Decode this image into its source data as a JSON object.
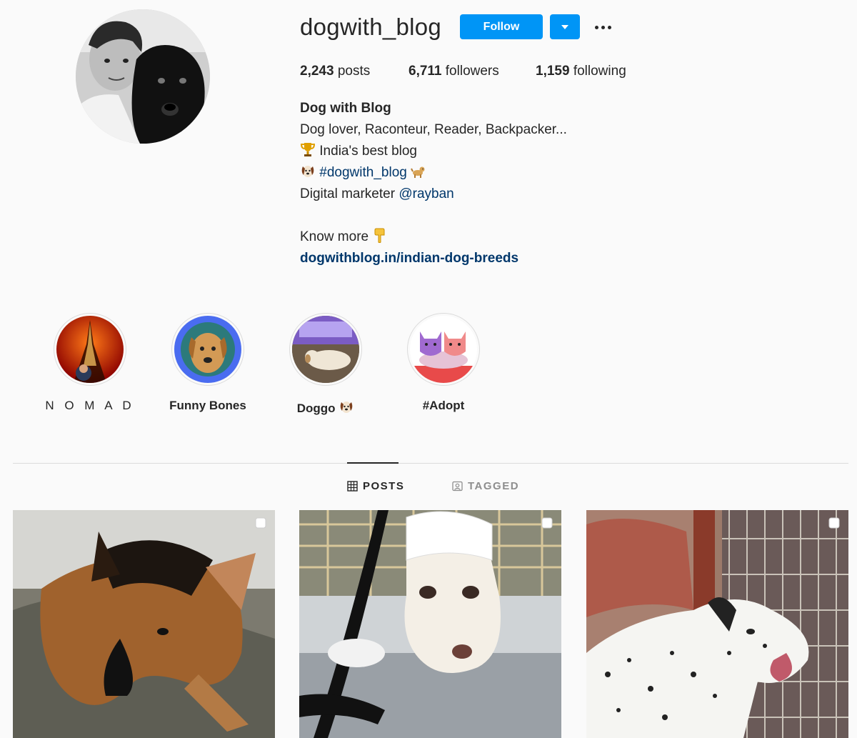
{
  "profile": {
    "username": "dogwith_blog",
    "follow_label": "Follow",
    "stats": {
      "posts_count": "2,243",
      "posts_label": "posts",
      "followers_count": "6,711",
      "followers_label": "followers",
      "following_count": "1,159",
      "following_label": "following"
    },
    "bio": {
      "full_name": "Dog with Blog",
      "line1": "Dog lover, Raconteur, Reader, Backpacker...",
      "line2": "India's best blog",
      "hashtag": "#dogwith_blog",
      "line4_text": "Digital marketer",
      "mention": "@rayban",
      "know_more": "Know more",
      "website": "dogwithblog.in/indian-dog-breeds"
    }
  },
  "highlights": [
    {
      "label": "N O M A D",
      "icon": "eiffel-tower"
    },
    {
      "label": "Funny Bones",
      "icon": "puppy"
    },
    {
      "label": "Doggo",
      "icon": "sleeping-dog"
    },
    {
      "label": "#Adopt",
      "icon": "cartoon-cats"
    }
  ],
  "tabs": {
    "posts": "POSTS",
    "tagged": "TAGGED",
    "active": "posts"
  },
  "posts": [
    {
      "subject": "german-shepherd",
      "multi": true
    },
    {
      "subject": "white-dog-bandaged",
      "multi": true
    },
    {
      "subject": "dalmatian",
      "multi": true
    }
  ],
  "colors": {
    "accent": "#0095f6",
    "text": "#262626",
    "muted": "#8e8e8e",
    "link": "#00376b",
    "background": "#fafafa",
    "border": "#dbdbdb"
  }
}
